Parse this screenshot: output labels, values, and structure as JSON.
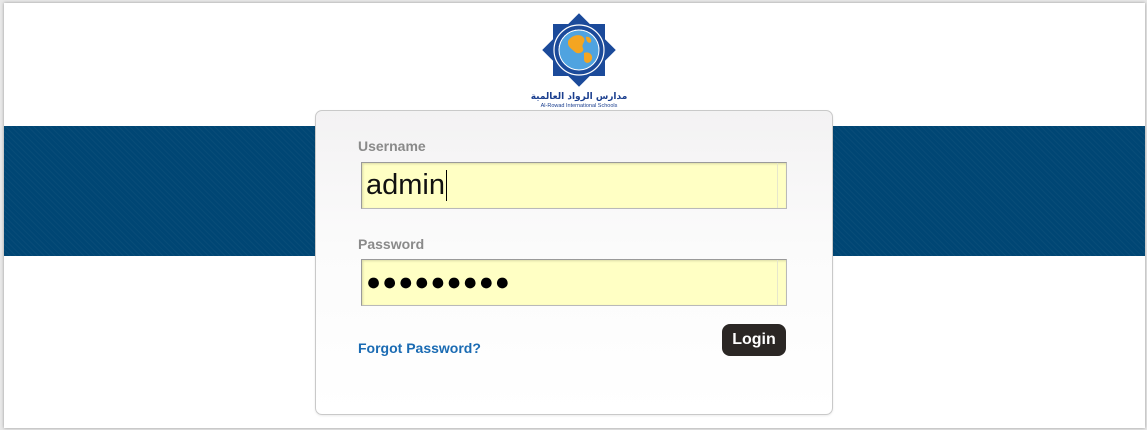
{
  "logo": {
    "icon": "globe-star-emblem",
    "text_arabic": "مدارس الرواد العالمية",
    "text_english": "Al-Rowad International Schools",
    "ring_text": "Al-Rowad International Schools",
    "colors": {
      "star": "#1b4a9a",
      "globe_land": "#f4a521",
      "globe_sea": "#4fa3e0"
    }
  },
  "login": {
    "username_label": "Username",
    "username_value": "admin",
    "password_label": "Password",
    "password_display": "●●●●●●●●●",
    "forgot_password": "Forgot Password?",
    "login_button": "Login"
  },
  "colors": {
    "band": "#004674",
    "field_background": "#ffffc4",
    "link": "#1a6bb3",
    "button": "#2b2725"
  }
}
